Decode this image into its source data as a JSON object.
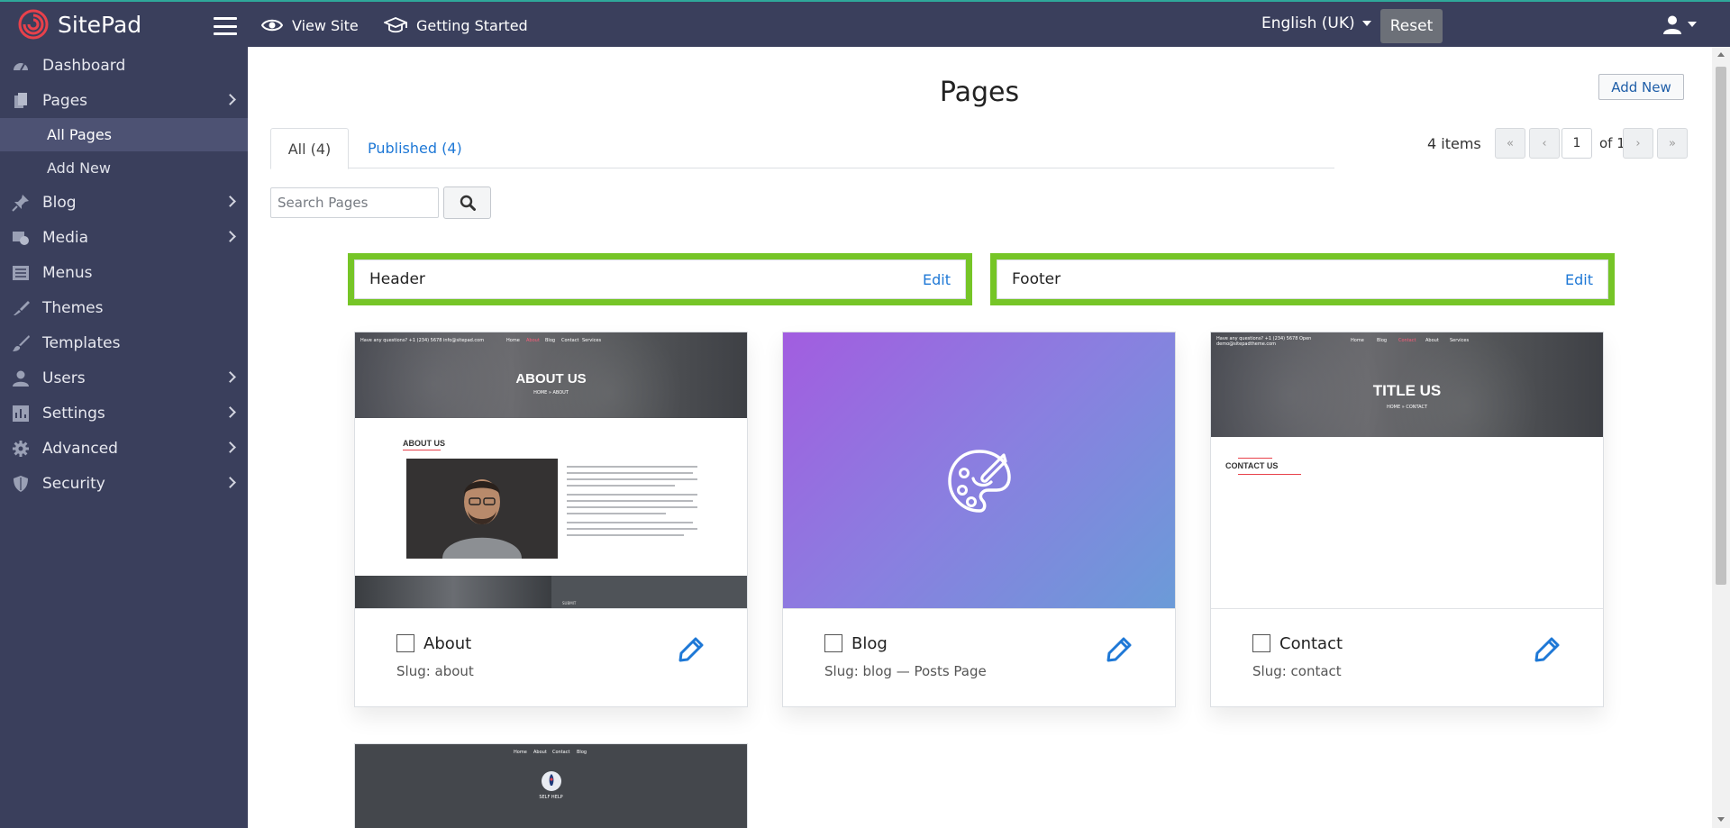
{
  "app": {
    "name": "SitePad"
  },
  "topbar": {
    "view_site": "View Site",
    "getting_started": "Getting Started",
    "language": "English (UK)",
    "reset": "Reset"
  },
  "sidebar": {
    "items": [
      {
        "label": "Dashboard",
        "icon": "dashboard-icon"
      },
      {
        "label": "Pages",
        "icon": "pages-icon",
        "expandable": true
      },
      {
        "label": "Blog",
        "icon": "pin-icon",
        "expandable": true
      },
      {
        "label": "Media",
        "icon": "media-icon",
        "expandable": true
      },
      {
        "label": "Menus",
        "icon": "menus-icon"
      },
      {
        "label": "Themes",
        "icon": "brush-icon"
      },
      {
        "label": "Templates",
        "icon": "paintbrush-icon"
      },
      {
        "label": "Users",
        "icon": "user-icon",
        "expandable": true
      },
      {
        "label": "Settings",
        "icon": "settings-icon",
        "expandable": true
      },
      {
        "label": "Advanced",
        "icon": "gear-icon",
        "expandable": true
      },
      {
        "label": "Security",
        "icon": "shield-icon",
        "expandable": true
      }
    ],
    "pages_sub": [
      "All Pages",
      "Add New"
    ]
  },
  "main": {
    "title": "Pages",
    "add_new": "Add New",
    "tabs": [
      "All (4)",
      "Published (4)"
    ],
    "items_count": "4 items",
    "pager": {
      "first": "«",
      "prev": "‹",
      "current": "1",
      "of": "of 1",
      "next": "›",
      "last": "»"
    },
    "search_placeholder": "Search Pages",
    "header_box": {
      "title": "Header",
      "edit": "Edit"
    },
    "footer_box": {
      "title": "Footer",
      "edit": "Edit"
    },
    "cards": [
      {
        "name": "About",
        "slug": "Slug: about"
      },
      {
        "name": "Blog",
        "slug": "Slug: blog — Posts Page"
      },
      {
        "name": "Contact",
        "slug": "Slug: contact"
      }
    ],
    "thumbs": {
      "about": {
        "hero_title": "ABOUT US",
        "crumb": "HOME » ABOUT",
        "section_heading": "ABOUT US",
        "nav": [
          "Home",
          "About",
          "Blog",
          "Contact",
          "Services"
        ],
        "top_info": "Have any questions?   +1 (234) 5678   info@sitepad.com",
        "footer_text": "SUBMIT"
      },
      "contact": {
        "hero_title": "TITLE US",
        "crumb": "HOME » CONTACT",
        "section_heading": "CONTACT US",
        "nav": [
          "Home",
          "Blog",
          "Contact",
          "About",
          "Services"
        ],
        "top_info": "Have any questions?   +1 (234) 5678 Open",
        "top_info_2": "demo@sitepadtheme.com"
      },
      "fourth": {
        "nav": [
          "Home",
          "About",
          "Contact",
          "Blog"
        ],
        "caption": "SELF HELP"
      }
    }
  },
  "colors": {
    "sidebar_bg": "#3a3f5c",
    "accent_green": "#76c527",
    "link_blue": "#1e78d6",
    "brand_red": "#e8414b"
  }
}
